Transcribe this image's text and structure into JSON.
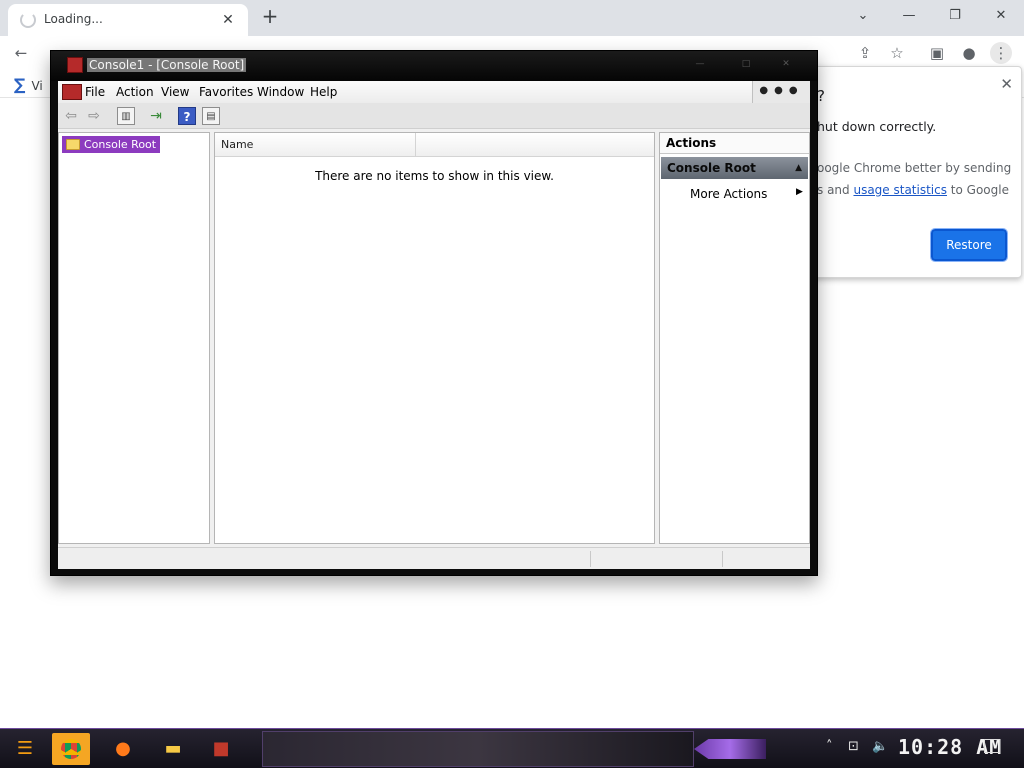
{
  "chrome": {
    "tab_title": "Loading...",
    "tab_close": "✕",
    "new_tab": "+",
    "win_minimize": "—",
    "win_maximize": "❐",
    "win_close": "✕",
    "tabsearch": "⌄",
    "bookmark_label": "Vi",
    "popup": {
      "question": "?",
      "line1": "hut down correctly.",
      "line2": "oogle Chrome better by sending",
      "line3_pre": "s and ",
      "line3_link": "usage statistics",
      "line3_post": " to Google",
      "restore_label": "Restore",
      "close": "✕"
    }
  },
  "mmc": {
    "title": "Console1 - [Console Root]",
    "menu": [
      "File",
      "Action",
      "View",
      "Favorites",
      "Window",
      "Help"
    ],
    "menu_dots": "●●●",
    "tree_root": "Console Root",
    "column_name": "Name",
    "empty_message": "There are no items to show in this view.",
    "actions_header": "Actions",
    "actions_group": "Console Root",
    "actions_item": "More Actions"
  },
  "taskbar": {
    "clock": "10:28 AM"
  },
  "colors": {
    "tree_selection": "#8c3bbf",
    "restore_button": "#1a73e8",
    "taskbar_accent": "#6d4a9c"
  },
  "icons": [
    "back-icon",
    "forward-icon",
    "reload-icon",
    "share-icon",
    "star-icon",
    "sidepanel-icon",
    "profile-icon",
    "menu-icon",
    "chrome-icon",
    "firefox-icon",
    "folder-icon",
    "mmc-icon",
    "network-icon",
    "volume-icon"
  ]
}
